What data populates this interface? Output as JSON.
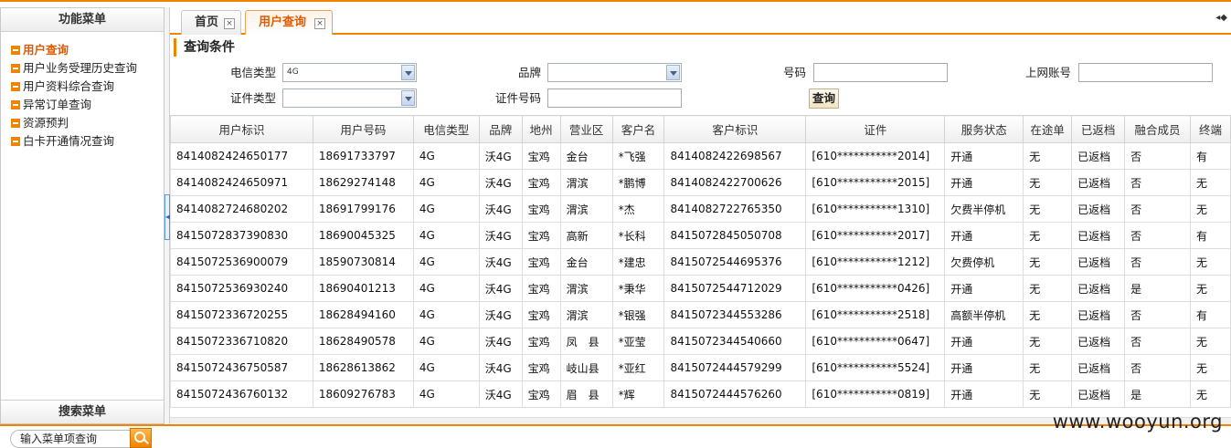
{
  "sidebar": {
    "title": "功能菜单",
    "items": [
      {
        "label": "用户查询",
        "active": true
      },
      {
        "label": "用户业务受理历史查询",
        "active": false
      },
      {
        "label": "用户资料综合查询",
        "active": false
      },
      {
        "label": "异常订单查询",
        "active": false
      },
      {
        "label": "资源预判",
        "active": false
      },
      {
        "label": "白卡开通情况查询",
        "active": false
      }
    ],
    "footer": "搜索菜单"
  },
  "tabs": [
    {
      "label": "首页",
      "close": "×"
    },
    {
      "label": "用户查询",
      "close": "×"
    }
  ],
  "tab_ctrl": "◂◆",
  "conditions": {
    "title": "查询条件",
    "telecom_type_label": "电信类型",
    "telecom_type_value": "4G",
    "brand_label": "品牌",
    "brand_value": "",
    "number_label": "号码",
    "number_value": "",
    "net_account_label": "上网账号",
    "net_account_value": "",
    "cert_type_label": "证件类型",
    "cert_type_value": "",
    "cert_number_label": "证件号码",
    "cert_number_value": "",
    "query_button": "查询"
  },
  "table": {
    "headers": [
      "用户标识",
      "用户号码",
      "电信类型",
      "品牌",
      "地州",
      "营业区",
      "客户名",
      "客户标识",
      "证件",
      "服务状态",
      "在途单",
      "已返档",
      "融合成员",
      "终端"
    ],
    "rows": [
      [
        "8414082424650177",
        "18691733797",
        "4G",
        "沃4G",
        "宝鸡",
        "金台",
        "*飞强",
        "8414082422698567",
        "[610***********2014]",
        "开通",
        "无",
        "已返档",
        "否",
        "有"
      ],
      [
        "8414082424650971",
        "18629274148",
        "4G",
        "沃4G",
        "宝鸡",
        "渭滨",
        "*鹏博",
        "8414082422700626",
        "[610***********2015]",
        "开通",
        "无",
        "已返档",
        "否",
        "无"
      ],
      [
        "8414082724680202",
        "18691799176",
        "4G",
        "沃4G",
        "宝鸡",
        "渭滨",
        "*杰",
        "8414082722765350",
        "[610***********1310]",
        "欠费半停机",
        "无",
        "已返档",
        "否",
        "无"
      ],
      [
        "8415072837390830",
        "18690045325",
        "4G",
        "沃4G",
        "宝鸡",
        "高新",
        "*长科",
        "8415072845050708",
        "[610***********2017]",
        "开通",
        "无",
        "已返档",
        "否",
        "有"
      ],
      [
        "8415072536900079",
        "18590730814",
        "4G",
        "沃4G",
        "宝鸡",
        "金台",
        "*建忠",
        "8415072544695376",
        "[610***********1212]",
        "欠费停机",
        "无",
        "已返档",
        "否",
        "无"
      ],
      [
        "8415072536930240",
        "18690401213",
        "4G",
        "沃4G",
        "宝鸡",
        "渭滨",
        "*秉华",
        "8415072544712029",
        "[610***********0426]",
        "开通",
        "无",
        "已返档",
        "是",
        "无"
      ],
      [
        "8415072336720255",
        "18628494160",
        "4G",
        "沃4G",
        "宝鸡",
        "渭滨",
        "*银强",
        "8415072344553286",
        "[610***********2518]",
        "高额半停机",
        "无",
        "已返档",
        "否",
        "有"
      ],
      [
        "8415072336710820",
        "18628490578",
        "4G",
        "沃4G",
        "宝鸡",
        "凤　县",
        "*亚莹",
        "8415072344540660",
        "[610***********0647]",
        "开通",
        "无",
        "已返档",
        "否",
        "无"
      ],
      [
        "8415072436750587",
        "18628613862",
        "4G",
        "沃4G",
        "宝鸡",
        "岐山县",
        "*亚红",
        "8415072444579299",
        "[610***********5524]",
        "开通",
        "无",
        "已返档",
        "否",
        "无"
      ],
      [
        "8415072436760132",
        "18609276783",
        "4G",
        "沃4G",
        "宝鸡",
        "眉　县",
        "*辉",
        "8415072444576260",
        "[610***********0819]",
        "开通",
        "无",
        "已返档",
        "是",
        "无"
      ]
    ]
  },
  "bottom": {
    "search_placeholder": "输入菜单项查询"
  },
  "watermark": "www.wooyun.org",
  "colors": {
    "accent": "#f08300",
    "active_text": "#e05a00"
  }
}
